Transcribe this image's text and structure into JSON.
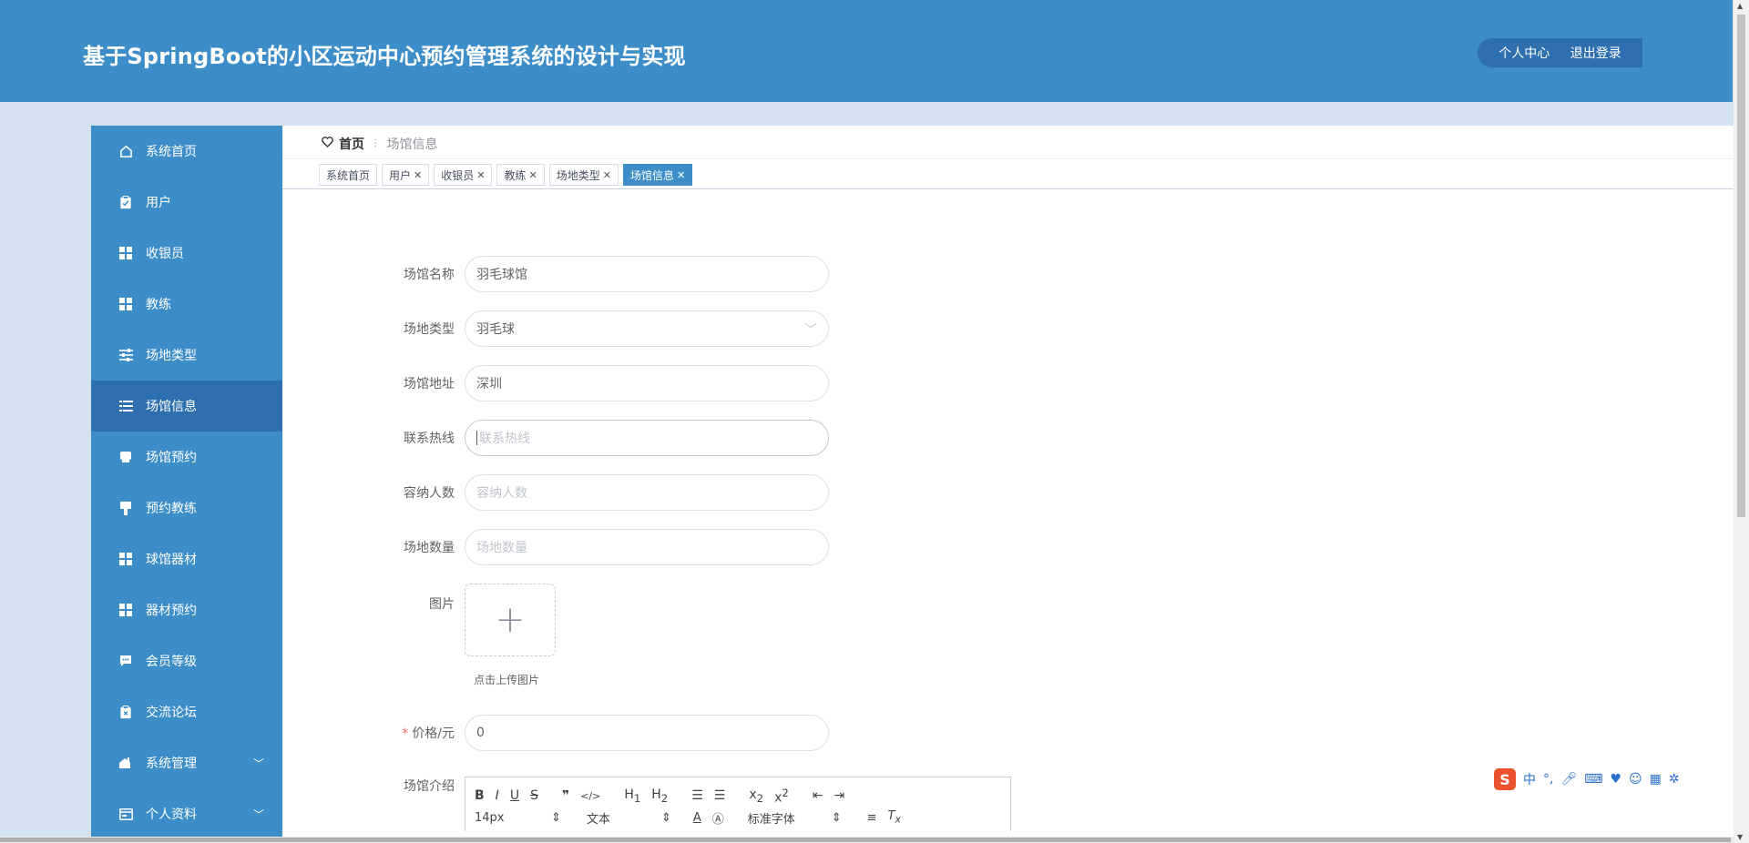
{
  "header": {
    "title": "基于SpringBoot的小区运动中心预约管理系统的设计与实现",
    "actions": [
      "个人中心",
      "退出登录"
    ]
  },
  "sidebar": {
    "items": [
      {
        "label": "系统首页",
        "icon": "home-icon"
      },
      {
        "label": "用户",
        "icon": "clipboard-icon"
      },
      {
        "label": "收银员",
        "icon": "grid-icon"
      },
      {
        "label": "教练",
        "icon": "grid-icon"
      },
      {
        "label": "场地类型",
        "icon": "sliders-icon"
      },
      {
        "label": "场馆信息",
        "icon": "list-icon",
        "active": true
      },
      {
        "label": "场馆预约",
        "icon": "printer-icon"
      },
      {
        "label": "预约教练",
        "icon": "brush-icon"
      },
      {
        "label": "球馆器材",
        "icon": "grid-icon"
      },
      {
        "label": "器材预约",
        "icon": "grid-icon"
      },
      {
        "label": "会员等级",
        "icon": "chat-icon"
      },
      {
        "label": "交流论坛",
        "icon": "clipboard-x-icon"
      },
      {
        "label": "系统管理",
        "icon": "house-settings-icon",
        "has_submenu": true
      },
      {
        "label": "个人资料",
        "icon": "card-icon",
        "has_submenu": true
      }
    ]
  },
  "breadcrumb": {
    "home": "首页",
    "current": "场馆信息"
  },
  "tags": [
    {
      "label": "系统首页",
      "closable": false
    },
    {
      "label": "用户",
      "closable": true
    },
    {
      "label": "收银员",
      "closable": true
    },
    {
      "label": "教练",
      "closable": true
    },
    {
      "label": "场地类型",
      "closable": true
    },
    {
      "label": "场馆信息",
      "closable": true,
      "active": true
    }
  ],
  "form": {
    "venue_name": {
      "label": "场馆名称",
      "value": "羽毛球馆"
    },
    "venue_type": {
      "label": "场地类型",
      "value": "羽毛球"
    },
    "venue_address": {
      "label": "场馆地址",
      "value": "深圳"
    },
    "hotline": {
      "label": "联系热线",
      "placeholder": "联系热线"
    },
    "capacity": {
      "label": "容纳人数",
      "placeholder": "容纳人数"
    },
    "court_count": {
      "label": "场地数量",
      "placeholder": "场地数量"
    },
    "image": {
      "label": "图片",
      "tip": "点击上传图片"
    },
    "price": {
      "label": "价格/元",
      "value": "0",
      "required_mark": "*"
    },
    "intro": {
      "label": "场馆介绍"
    }
  },
  "editor": {
    "font_size": "14px",
    "text_style": "文本",
    "font_family": "标准字体"
  },
  "ime": {
    "logo": "S",
    "mode": "中"
  },
  "colors": {
    "primary": "#3d8ec8",
    "active": "#2e6fb0",
    "background": "#d3e2ee"
  }
}
